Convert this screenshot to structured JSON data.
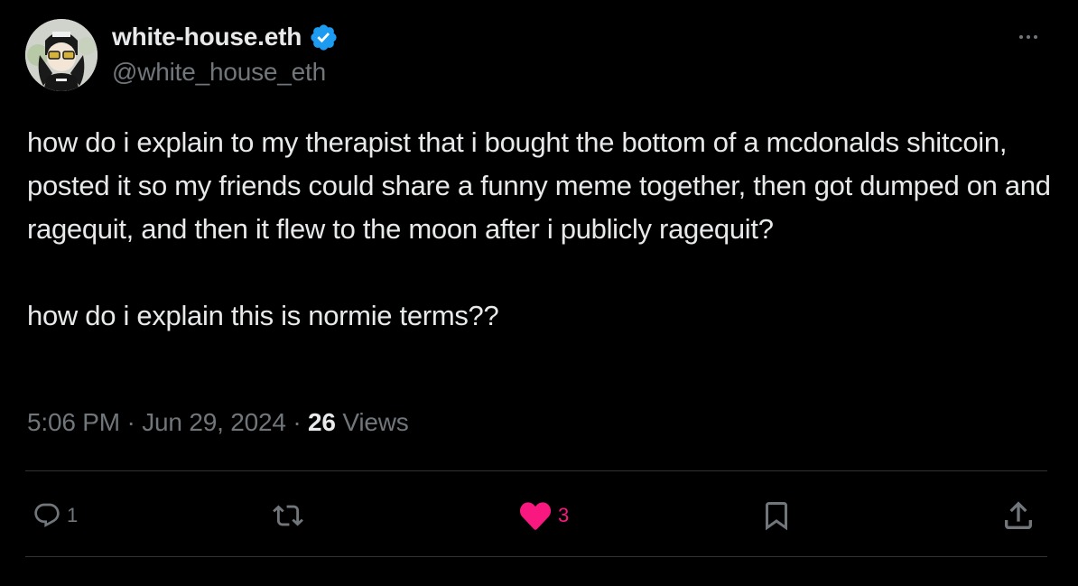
{
  "author": {
    "display_name": "white-house.eth",
    "handle": "@white_house_eth",
    "verified": true,
    "avatar_icon": "avatar-icon"
  },
  "tweet": {
    "paragraphs": [
      "how do i explain to my therapist that i bought the bottom of a mcdonalds shitcoin, posted it so my friends could share a funny meme together, then got dumped on and ragequit, and then it flew to the moon after i publicly ragequit?",
      "how do i explain this is normie terms??"
    ]
  },
  "meta": {
    "time": "5:06 PM",
    "separator": "·",
    "date": "Jun 29, 2024",
    "views_count": "26",
    "views_label": "Views"
  },
  "actions": {
    "reply": {
      "icon": "reply-icon",
      "count": "1"
    },
    "retweet": {
      "icon": "retweet-icon",
      "count": ""
    },
    "like": {
      "icon": "heart-icon",
      "count": "3",
      "liked": true
    },
    "bookmark": {
      "icon": "bookmark-icon"
    },
    "share": {
      "icon": "share-icon"
    }
  },
  "colors": {
    "background": "#000000",
    "primary_text": "#e7e9ea",
    "secondary_text": "#71767b",
    "divider": "#2f3336",
    "verified_blue": "#1d9bf0",
    "like_pink": "#f91880"
  }
}
